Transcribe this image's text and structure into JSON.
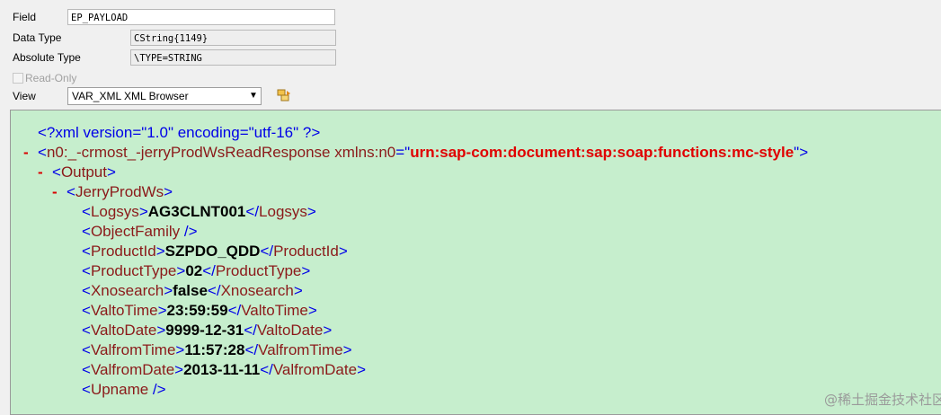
{
  "form": {
    "field_label": "Field",
    "field_value": "EP_PAYLOAD",
    "datatype_label": "Data Type",
    "datatype_value": "CString{1149}",
    "abstype_label": "Absolute Type",
    "abstype_value": "\\TYPE=STRING",
    "readonly_label": "Read-Only",
    "view_label": "View",
    "view_value": "VAR_XML XML Browser"
  },
  "xml": {
    "decl": "<?xml version=\"1.0\" encoding=\"utf-16\" ?>",
    "collapse": "-",
    "root_open": "<",
    "root_tag": "n0:_-crmost_-jerryProdWsReadResponse",
    "root_attr": " xmlns:n0",
    "root_eq": "=\"",
    "root_attr_value": "urn:sap-com:document:sap:soap:functions:mc-style",
    "root_close": "\">",
    "output_open": "<",
    "output_tag": "Output",
    "output_close": ">",
    "jpw_open": "<",
    "jpw_tag": "JerryProdWs",
    "jpw_close": ">",
    "fields": [
      {
        "tag": "Logsys",
        "value": "AG3CLNT001"
      },
      {
        "tag": "ObjectFamily",
        "value": ""
      },
      {
        "tag": "ProductId",
        "value": "SZPDO_QDD"
      },
      {
        "tag": "ProductType",
        "value": "02"
      },
      {
        "tag": "Xnosearch",
        "value": "false"
      },
      {
        "tag": "ValtoTime",
        "value": "23:59:59"
      },
      {
        "tag": "ValtoDate",
        "value": "9999-12-31"
      },
      {
        "tag": "ValfromTime",
        "value": "11:57:28"
      },
      {
        "tag": "ValfromDate",
        "value": "2013-11-11"
      },
      {
        "tag": "Upname",
        "value": ""
      }
    ],
    "lt": "<",
    "gt": ">",
    "close_lt": "</",
    "selfclose": " />"
  },
  "watermark": "@稀土掘金技术社区"
}
